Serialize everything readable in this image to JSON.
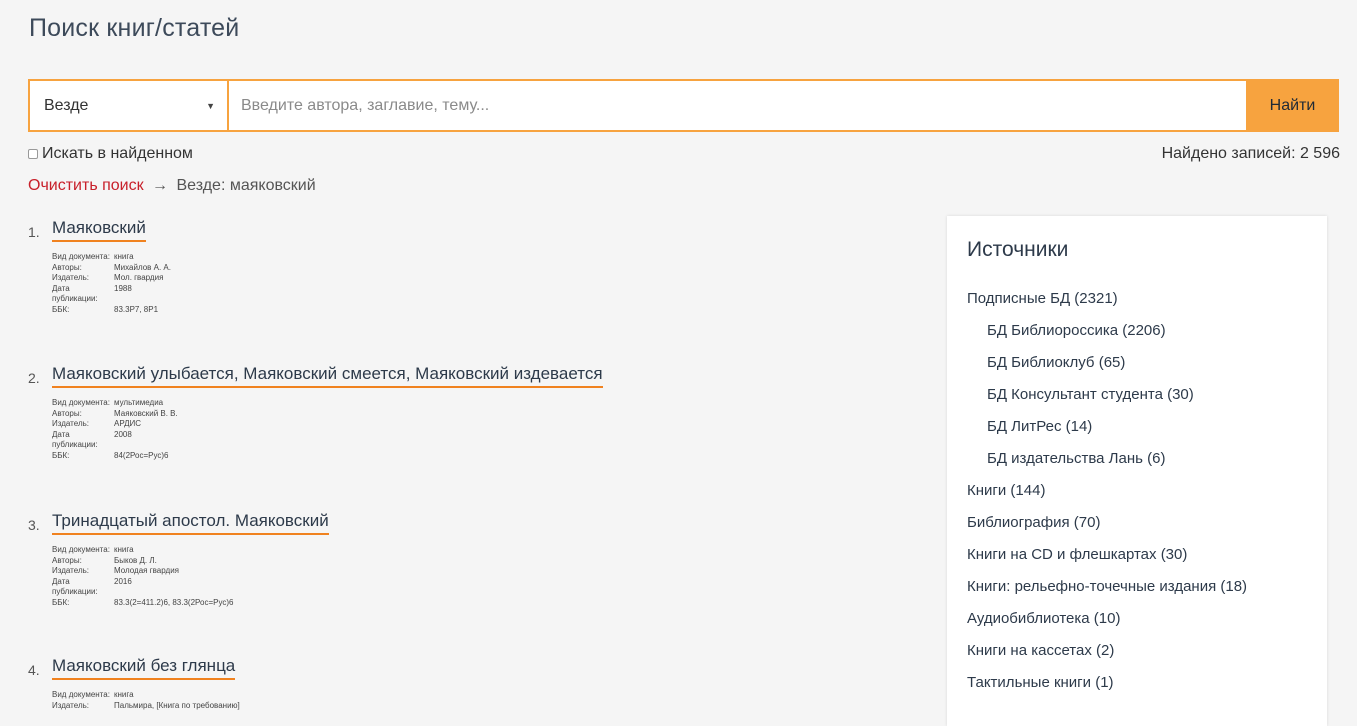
{
  "page": {
    "title": "Поиск книг/статей"
  },
  "search": {
    "scope_value": "Везде",
    "placeholder": "Введите автора, заглавие, тему...",
    "value": "",
    "button_label": "Найти"
  },
  "refine": {
    "label": "Искать в найденном",
    "checked": false
  },
  "found": {
    "text": "Найдено записей: 2 596"
  },
  "breadcrumb": {
    "clear_label": "Очистить поиск",
    "arrow": "→",
    "query_text": "Везде: маяковский"
  },
  "meta_labels": {
    "doc_type": "Вид документа:",
    "authors": "Авторы:",
    "publisher": "Издатель:",
    "date": "Дата публикации:",
    "bbk": "ББК:"
  },
  "results": [
    {
      "num": "1.",
      "title": "Маяковский",
      "doc_type": "книга",
      "authors": "Михайлов А. А.",
      "publisher": "Мол. гвардия",
      "date": "1988",
      "bbk": "83.3Р7, 8Р1"
    },
    {
      "num": "2.",
      "title": "Маяковский улыбается, Маяковский смеется, Маяковский издевается",
      "doc_type": "мультимедиа",
      "authors": "Маяковский В. В.",
      "publisher": "АРДИС",
      "date": "2008",
      "bbk": "84(2Рос=Рус)6"
    },
    {
      "num": "3.",
      "title": "Тринадцатый апостол. Маяковский",
      "doc_type": "книга",
      "authors": "Быков Д. Л.",
      "publisher": "Молодая гвардия",
      "date": "2016",
      "bbk": "83.3(2=411.2)6, 83.3(2Рос=Рус)6"
    },
    {
      "num": "4.",
      "title": "Маяковский без глянца",
      "doc_type": "книга",
      "publisher": "Пальмира, [Книга по требованию]"
    }
  ],
  "sources": {
    "title": "Источники",
    "items": [
      {
        "label": "Подписные БД (2321)"
      },
      {
        "label": "БД Библиороссика (2206)"
      },
      {
        "label": "БД Библиоклуб (65)"
      },
      {
        "label": "БД Консультант студента (30)"
      },
      {
        "label": "БД ЛитРес (14)"
      },
      {
        "label": "БД издательства Лань (6)"
      },
      {
        "label": "Книги (144)"
      },
      {
        "label": "Библиография (70)"
      },
      {
        "label": "Книги на CD и флешкартах (30)"
      },
      {
        "label": "Книги: рельефно-точечные издания (18)"
      },
      {
        "label": "Аудиобиблиотека (10)"
      },
      {
        "label": "Книги на кассетах (2)"
      },
      {
        "label": "Тактильные книги (1)"
      }
    ]
  }
}
